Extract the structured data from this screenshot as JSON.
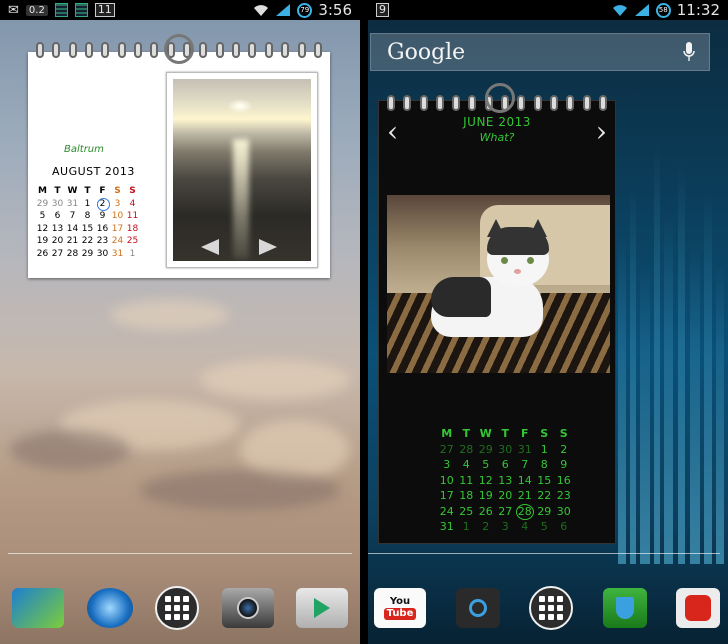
{
  "left_screen": {
    "status_bar": {
      "data_value": "0.2",
      "badge": "11",
      "time": "3:56",
      "battery_level": "79"
    },
    "calendar": {
      "place": "Baltrum",
      "month_title": "AUGUST  2013",
      "weekdays": [
        "M",
        "T",
        "W",
        "T",
        "F",
        "S",
        "S"
      ],
      "weeks": [
        [
          "29",
          "30",
          "31",
          "1",
          "2",
          "3",
          "4"
        ],
        [
          "5",
          "6",
          "7",
          "8",
          "9",
          "10",
          "11"
        ],
        [
          "12",
          "13",
          "14",
          "15",
          "16",
          "17",
          "18"
        ],
        [
          "19",
          "20",
          "21",
          "22",
          "23",
          "24",
          "25"
        ],
        [
          "26",
          "27",
          "28",
          "29",
          "30",
          "31",
          "1"
        ]
      ]
    },
    "dock": [
      "Phone",
      "Browser",
      "Apps",
      "Camera",
      "Play Store"
    ]
  },
  "right_screen": {
    "status_bar": {
      "badge": "9",
      "time": "11:32",
      "battery_level": "58"
    },
    "search": {
      "logo": "Google"
    },
    "calendar": {
      "month_title": "JUNE  2013",
      "caption": "What?",
      "nav_prev": "‹",
      "nav_next": "›",
      "weekdays": [
        "M",
        "T",
        "W",
        "T",
        "F",
        "S",
        "S"
      ],
      "weeks": [
        [
          "27",
          "28",
          "29",
          "30",
          "31",
          "1",
          "2"
        ],
        [
          "3",
          "4",
          "5",
          "6",
          "7",
          "8",
          "9"
        ],
        [
          "10",
          "11",
          "12",
          "13",
          "14",
          "15",
          "16"
        ],
        [
          "17",
          "18",
          "19",
          "20",
          "21",
          "22",
          "23"
        ],
        [
          "24",
          "25",
          "26",
          "27",
          "28",
          "29",
          "30"
        ],
        [
          "31",
          "1",
          "2",
          "3",
          "4",
          "5",
          "6"
        ]
      ]
    },
    "dock": [
      "YouTube",
      "Settings",
      "Apps",
      "Security",
      "AnTuTu"
    ]
  },
  "colors": {
    "calendar_green": "#35c635",
    "saturday": "#d07018",
    "sunday": "#c0101c",
    "today_ring_left": "#3478d8"
  }
}
